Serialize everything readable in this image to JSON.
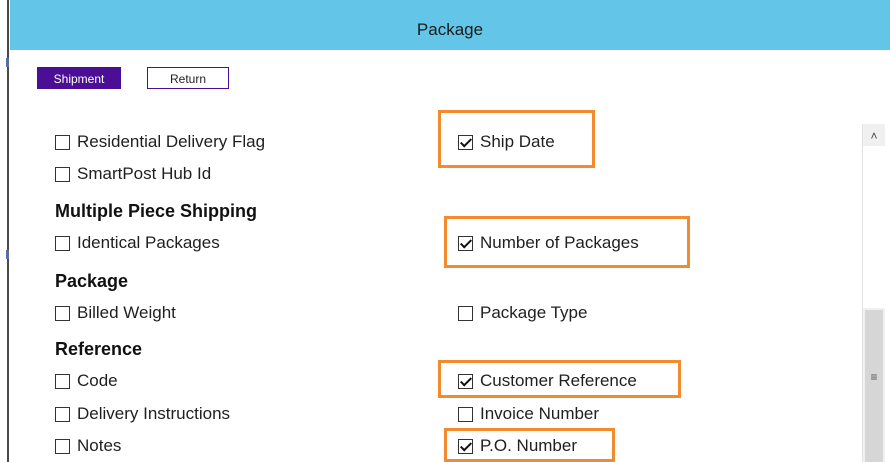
{
  "window": {
    "title": "Package"
  },
  "tabs": {
    "shipment": "Shipment",
    "return": "Return"
  },
  "left_column": {
    "residential": "Residential Delivery Flag",
    "smartpost": "SmartPost Hub Id",
    "heading_multi": "Multiple Piece Shipping",
    "identical": "Identical Packages",
    "heading_package": "Package",
    "billed_weight": "Billed Weight",
    "heading_reference": "Reference",
    "code": "Code",
    "delivery_instructions": "Delivery Instructions",
    "notes": "Notes"
  },
  "right_column": {
    "ship_date": "Ship Date",
    "number_of_packages": "Number of Packages",
    "package_type": "Package Type",
    "customer_reference": "Customer Reference",
    "invoice_number": "Invoice Number",
    "po_number": "P.O. Number"
  },
  "checked": {
    "residential": false,
    "smartpost": false,
    "identical": false,
    "billed_weight": false,
    "code": false,
    "delivery_instructions": false,
    "notes": false,
    "ship_date": true,
    "number_of_packages": true,
    "package_type": false,
    "customer_reference": true,
    "invoice_number": false,
    "po_number": true
  },
  "colors": {
    "titlebar": "#63c6e8",
    "accent": "#4b0f96",
    "highlight": "#f28a2e"
  },
  "icons": {
    "scroll_up": "chevron-up-icon",
    "scroll_grip": "grip-icon"
  }
}
